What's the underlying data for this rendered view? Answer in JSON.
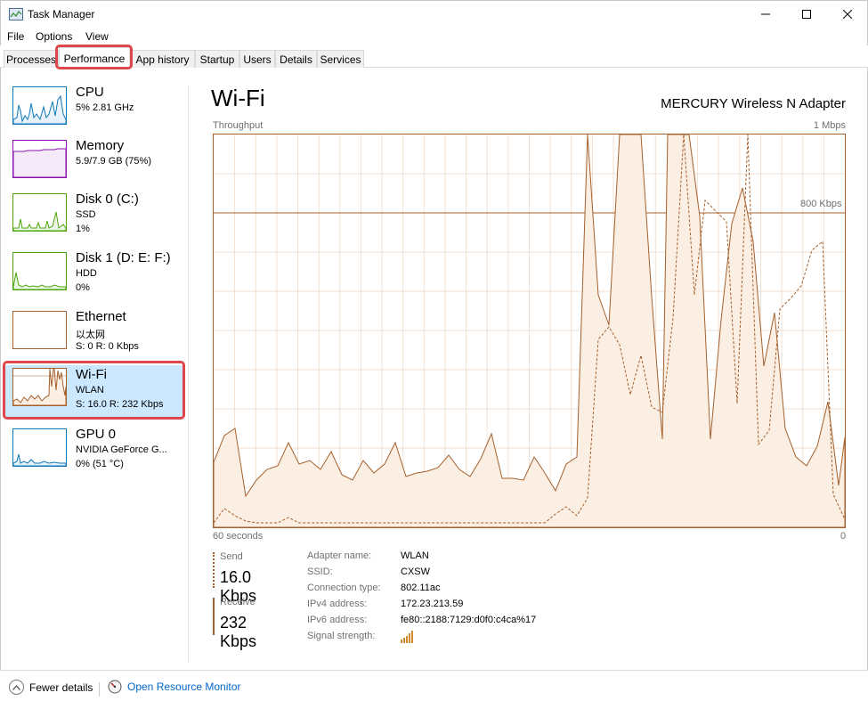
{
  "window": {
    "title": "Task Manager"
  },
  "menu": [
    "File",
    "Options",
    "View"
  ],
  "tabs": [
    "Processes",
    "Performance",
    "App history",
    "Startup",
    "Users",
    "Details",
    "Services"
  ],
  "active_tab": "Performance",
  "sidebar": {
    "items": [
      {
        "name": "CPU",
        "line1": "5%  2.81 GHz",
        "line2": "",
        "color": "#1178b7",
        "icon": "cpu-graph"
      },
      {
        "name": "Memory",
        "line1": "5.9/7.9 GB (75%)",
        "line2": "",
        "color": "#8b12ae",
        "icon": "memory-graph"
      },
      {
        "name": "Disk 0 (C:)",
        "line1": "SSD",
        "line2": "1%",
        "color": "#4da60c",
        "icon": "disk-graph"
      },
      {
        "name": "Disk 1 (D: E: F:)",
        "line1": "HDD",
        "line2": "0%",
        "color": "#4da60c",
        "icon": "disk-graph"
      },
      {
        "name": "Ethernet",
        "line1": "以太网",
        "line2": "S: 0  R: 0 Kbps",
        "color": "#a5602c",
        "icon": "network-graph"
      },
      {
        "name": "Wi-Fi",
        "line1": "WLAN",
        "line2": "S: 16.0  R: 232 Kbps",
        "color": "#a5602c",
        "icon": "network-graph"
      },
      {
        "name": "GPU 0",
        "line1": "NVIDIA GeForce G...",
        "line2": "0% (51 °C)",
        "color": "#1178b7",
        "icon": "gpu-graph"
      }
    ],
    "selected_index": 5
  },
  "main": {
    "title": "Wi-Fi",
    "adapter": "MERCURY Wireless N Adapter",
    "throughput_label": "Throughput",
    "max_label": "1 Mbps",
    "mark_label": "800 Kbps",
    "time_label": "60 seconds",
    "zero_label": "0",
    "send_label": "Send",
    "send_value": "16.0 Kbps",
    "receive_label": "Receive",
    "receive_value": "232 Kbps",
    "properties": [
      {
        "key": "Adapter name:",
        "value": "WLAN"
      },
      {
        "key": "SSID:",
        "value": "CXSW"
      },
      {
        "key": "Connection type:",
        "value": "802.11ac"
      },
      {
        "key": "IPv4 address:",
        "value": "172.23.213.59"
      },
      {
        "key": "IPv6 address:",
        "value": "fe80::2188:7129:d0f0:c4ca%17"
      },
      {
        "key": "Signal strength:",
        "value": ""
      }
    ]
  },
  "footer": {
    "fewer_details": "Fewer details",
    "resource_monitor": "Open Resource Monitor"
  },
  "colors": {
    "accent_network": "#a5602c",
    "selected_bg": "#cce8ff",
    "highlight": "#e0474c",
    "link": "#0066cc"
  }
}
